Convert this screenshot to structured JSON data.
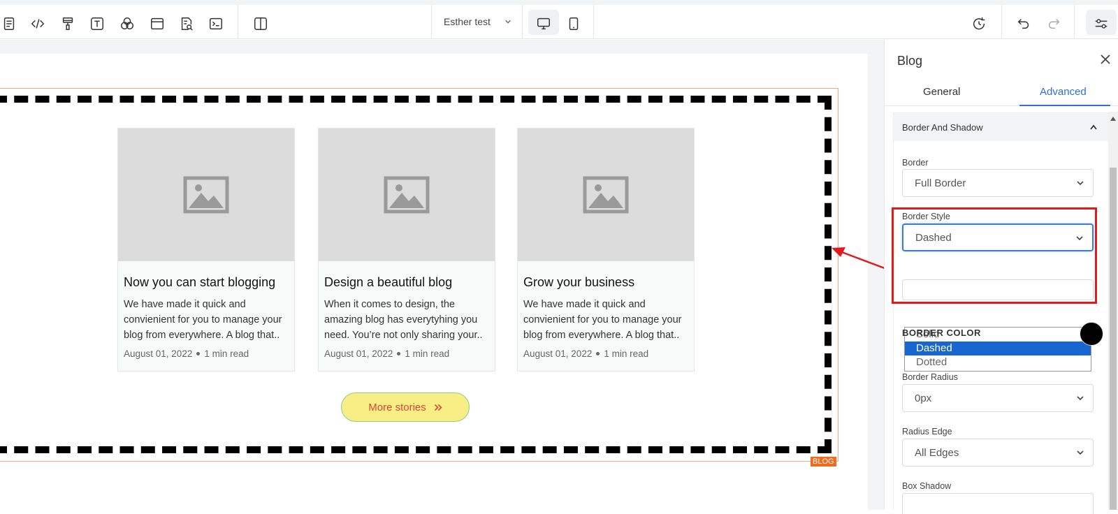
{
  "toolbar": {
    "project_name": "Esther test",
    "left_icons": [
      "form-icon",
      "code-icon",
      "paint-brush-icon",
      "text-icon",
      "shapes-icon",
      "browser-window-icon",
      "page-search-icon",
      "terminal-icon",
      "split-view-icon"
    ],
    "right_icons": [
      "history-icon",
      "undo-icon",
      "redo-icon",
      "settings-sliders-icon"
    ]
  },
  "blog": {
    "badge": "BLOG",
    "posts": [
      {
        "title": "Now you can start blogging",
        "excerpt": "We have made it quick and convienient for you to manage your blog from everywhere. A blog that..",
        "date": "August 01, 2022",
        "read_time": "1 min read"
      },
      {
        "title": "Design a beautiful blog",
        "excerpt": "When it comes to design, the amazing blog has everytyhing you need. You’re not only sharing your..",
        "date": "August 01, 2022",
        "read_time": "1 min read"
      },
      {
        "title": "Grow your business",
        "excerpt": "We have made it quick and convienient for you to manage your blog from everywhere. A blog that..",
        "date": "August 01, 2022",
        "read_time": "1 min read"
      }
    ],
    "more_button": "More stories",
    "more_icon": "double-chevron-right-icon"
  },
  "panel": {
    "title": "Blog",
    "tabs": [
      "General",
      "Advanced"
    ],
    "active_tab": "Advanced",
    "section_title": "Border And Shadow",
    "border_label": "Border",
    "border_value": "Full Border",
    "border_style_label": "Border Style",
    "border_style_value": "Dashed",
    "border_style_options": [
      "Solid",
      "Dashed",
      "Dotted"
    ],
    "border_color_label": "BORDER COLOR",
    "border_color_value": "#000000",
    "border_radius_label": "Border Radius",
    "border_radius_value": "0px",
    "radius_edge_label": "Radius Edge",
    "radius_edge_value": "All Edges",
    "box_shadow_label": "Box Shadow"
  },
  "colors": {
    "accent": "#2f6fd6",
    "highlight_red": "#e01b1b",
    "button_fill": "#f7ee86",
    "button_text": "#e0443a",
    "badge": "#f26b1d"
  }
}
